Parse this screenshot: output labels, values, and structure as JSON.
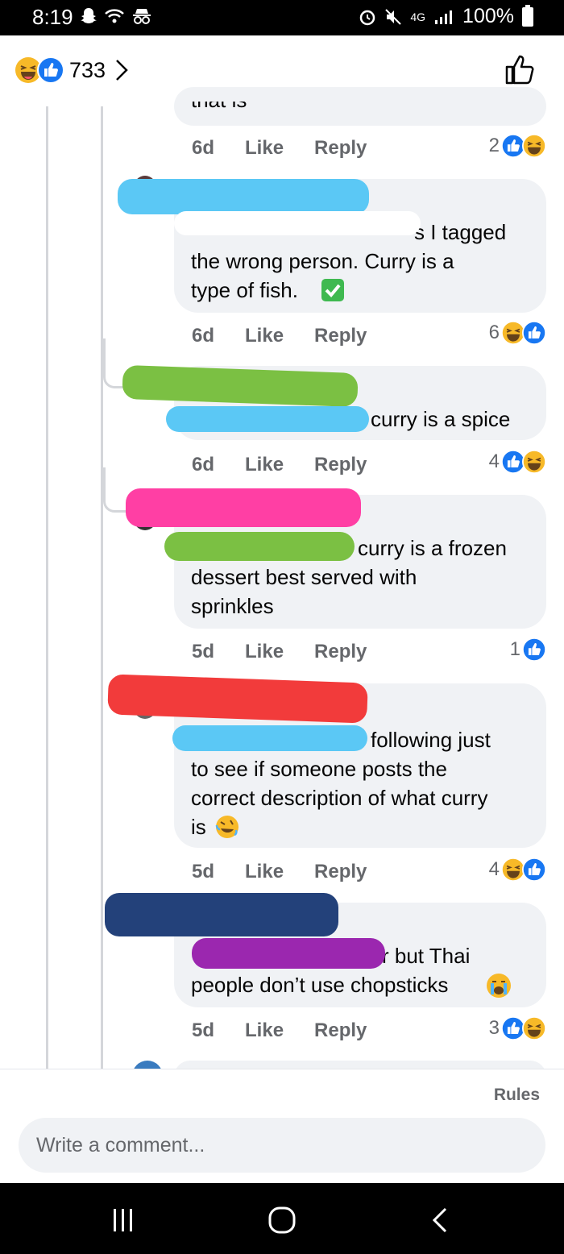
{
  "status_bar": {
    "time": "8:19",
    "battery_text": "100%",
    "network_text": "4G"
  },
  "header": {
    "reaction_count": "733"
  },
  "comments": [
    {
      "text": "that is",
      "age": "6d",
      "like_label": "Like",
      "reply_label": "Reply",
      "reaction_count": "2",
      "reaction_icons": [
        "like-icon",
        "haha-icon"
      ]
    },
    {
      "text_line1": "s I tagged",
      "text_line2": "the wrong person. Curry is a",
      "text_line3": "type of fish.",
      "emoji": "check-mark-emoji",
      "age": "6d",
      "like_label": "Like",
      "reply_label": "Reply",
      "reaction_count": "6",
      "reaction_icons": [
        "haha-icon",
        "like-icon"
      ]
    },
    {
      "text_line1": "curry is a spice",
      "age": "6d",
      "like_label": "Like",
      "reply_label": "Reply",
      "reaction_count": "4",
      "reaction_icons": [
        "like-icon",
        "haha-icon"
      ]
    },
    {
      "text_line1": "curry is a frozen",
      "text_line2": "dessert best served with",
      "text_line3": "sprinkles",
      "age": "5d",
      "like_label": "Like",
      "reply_label": "Reply",
      "reaction_count": "1",
      "reaction_icons": [
        "like-icon"
      ]
    },
    {
      "text_line1": "following just",
      "text_line2": "to see if someone posts the",
      "text_line3": "correct description of what curry",
      "text_line4": "is",
      "emoji": "rolling-laughing-emoji",
      "age": "5d",
      "like_label": "Like",
      "reply_label": "Reply",
      "reaction_count": "4",
      "reaction_icons": [
        "haha-icon",
        "like-icon"
      ]
    },
    {
      "text_line1": "r but Thai",
      "text_line2": "people don’t use chopsticks",
      "emoji": "crying-emoji",
      "age": "5d",
      "like_label": "Like",
      "reply_label": "Reply",
      "reaction_count": "3",
      "reaction_icons": [
        "like-icon",
        "haha-icon"
      ]
    }
  ],
  "footer": {
    "rules_label": "Rules",
    "comment_placeholder": "Write a comment..."
  },
  "colors": {
    "like_blue": "#1877f2",
    "haha_yellow": "#f7b928",
    "redaction_cyan": "#5bc8f5",
    "redaction_green": "#7bc043",
    "redaction_pink": "#ff3fa4",
    "redaction_red": "#f23b3b",
    "redaction_navy": "#23417a",
    "redaction_purple": "#9b27af"
  }
}
